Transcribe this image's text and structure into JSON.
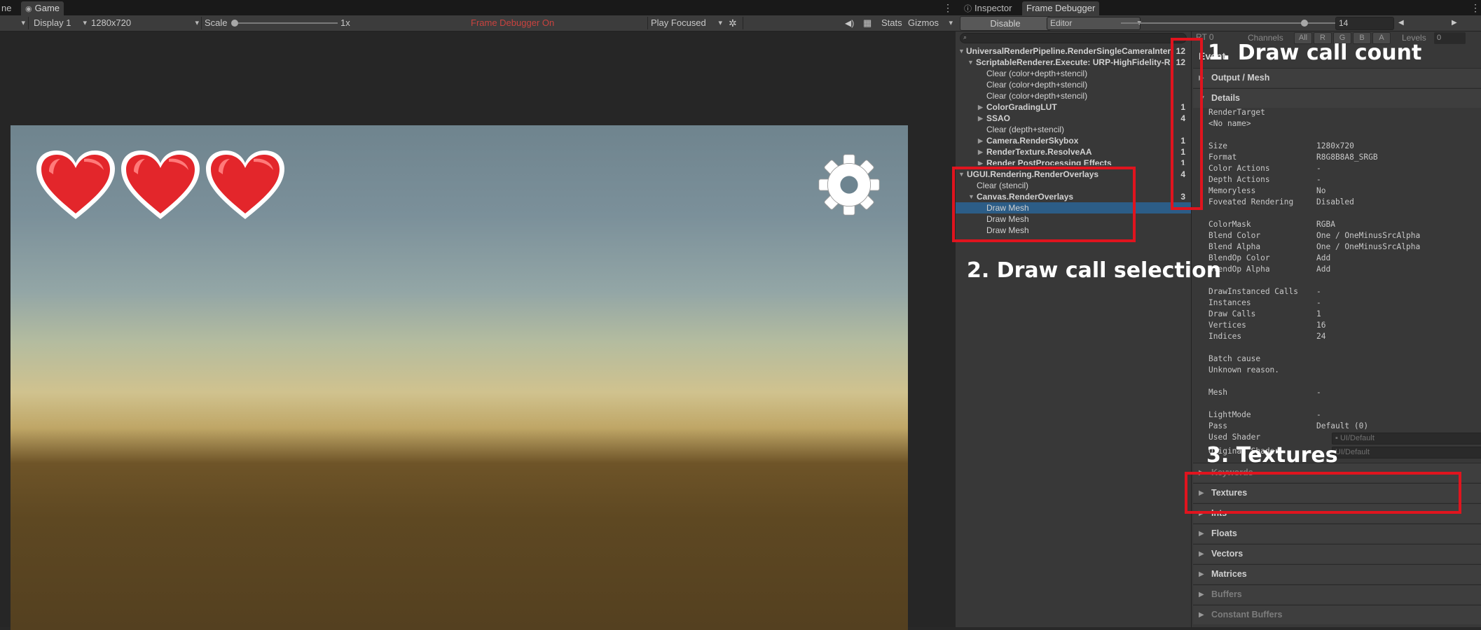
{
  "left_tabs": {
    "scene_partial": "ne",
    "game": "Game"
  },
  "game_toolbar": {
    "display": "Display 1",
    "resolution": "1280x720",
    "scale_label": "Scale",
    "scale_value": "1x",
    "frame_debugger_status": "Frame Debugger On",
    "play_mode": "Play Focused",
    "stats": "Stats",
    "gizmos": "Gizmos"
  },
  "game_view": {
    "hearts_count": 3,
    "heart_color": "#e3262b",
    "gear_color": "#ffffff"
  },
  "right_tabs": {
    "inspector": "Inspector",
    "frame_debugger": "Frame Debugger"
  },
  "fd_toolbar": {
    "disable": "Disable",
    "target": "Editor",
    "event_index": "14"
  },
  "channels": {
    "rt": "RT 0",
    "label": "Channels",
    "all": "All",
    "r": "R",
    "g": "G",
    "b": "B",
    "a": "A",
    "levels": "Levels",
    "levels_value": "0"
  },
  "tree": {
    "search_placeholder": "",
    "rows": [
      {
        "label": "UniversalRenderPipeline.RenderSingleCameraInter",
        "count": "12"
      },
      {
        "label": "ScriptableRenderer.Execute: URP-HighFidelity-R",
        "count": "12"
      },
      {
        "label": "Clear (color+depth+stencil)",
        "count": ""
      },
      {
        "label": "Clear (color+depth+stencil)",
        "count": ""
      },
      {
        "label": "Clear (color+depth+stencil)",
        "count": ""
      },
      {
        "label": "ColorGradingLUT",
        "count": "1"
      },
      {
        "label": "SSAO",
        "count": "4"
      },
      {
        "label": "Clear (depth+stencil)",
        "count": ""
      },
      {
        "label": "Camera.RenderSkybox",
        "count": "1"
      },
      {
        "label": "RenderTexture.ResolveAA",
        "count": "1"
      },
      {
        "label": "Render PostProcessing Effects",
        "count": "1"
      },
      {
        "label": "UGUI.Rendering.RenderOverlays",
        "count": "4"
      },
      {
        "label": "Clear (stencil)",
        "count": ""
      },
      {
        "label": "Canvas.RenderOverlays",
        "count": "3"
      },
      {
        "label": "Draw Mesh",
        "count": ""
      },
      {
        "label": "Draw Mesh",
        "count": ""
      },
      {
        "label": "Draw Mesh",
        "count": ""
      }
    ]
  },
  "details": {
    "event_title_partial": "Event",
    "output_mesh": "Output / Mesh",
    "details_header": "Details",
    "render_target_label": "RenderTarget",
    "render_target_value": "<No name>",
    "props1": [
      {
        "k": "Size",
        "v": "1280x720"
      },
      {
        "k": "Format",
        "v": "R8G8B8A8_SRGB"
      },
      {
        "k": "Color Actions",
        "v": "-"
      },
      {
        "k": "Depth Actions",
        "v": "-"
      },
      {
        "k": "Memoryless",
        "v": "No"
      },
      {
        "k": "Foveated Rendering",
        "v": "Disabled"
      }
    ],
    "props2": [
      {
        "k": "ColorMask",
        "v": "RGBA"
      },
      {
        "k": "Blend Color",
        "v": "One / OneMinusSrcAlpha"
      },
      {
        "k": "Blend Alpha",
        "v": "One / OneMinusSrcAlpha"
      },
      {
        "k": "BlendOp Color",
        "v": "Add"
      },
      {
        "k": "BlendOp Alpha",
        "v": "Add"
      }
    ],
    "props3": [
      {
        "k": "DrawInstanced Calls",
        "v": "-"
      },
      {
        "k": "Instances",
        "v": "-"
      },
      {
        "k": "Draw Calls",
        "v": "1"
      },
      {
        "k": "Vertices",
        "v": "16"
      },
      {
        "k": "Indices",
        "v": "24"
      }
    ],
    "batch_cause_label": "Batch cause",
    "batch_cause_value": "Unknown reason.",
    "mesh_label": "Mesh",
    "mesh_value": "-",
    "lightmode_label": "LightMode",
    "lightmode_value": "-",
    "pass_label": "Pass",
    "pass_value": "Default (0)",
    "used_shader_label": "Used Shader",
    "used_shader_value": "UI/Default",
    "original_shader_label": "Original Shader",
    "original_shader_value": "UI/Default",
    "keywords": "Keywords",
    "sections": [
      "Textures",
      "Ints",
      "Floats",
      "Vectors",
      "Matrices",
      "Buffers",
      "Constant Buffers"
    ]
  },
  "annotations": {
    "a1": "1. Draw call count",
    "a2": "2. Draw call selection",
    "a3": "3. Textures",
    "box_color": "#e0141e"
  }
}
